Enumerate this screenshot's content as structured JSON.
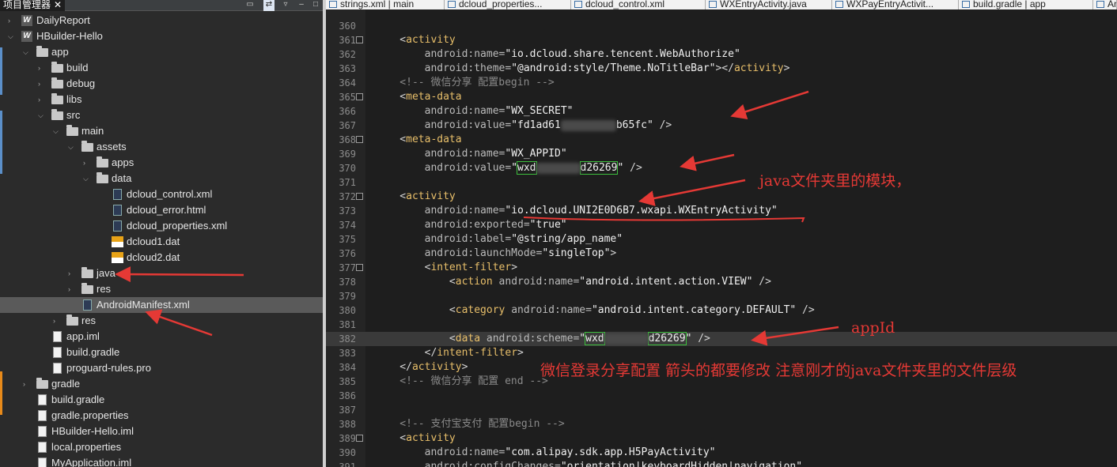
{
  "panel": {
    "title": "项目管理器",
    "close": "✕"
  },
  "tree": [
    {
      "depth": 0,
      "arrow": "right",
      "icon": "w",
      "label": "DailyReport"
    },
    {
      "depth": 0,
      "arrow": "down",
      "icon": "w",
      "label": "HBuilder-Hello"
    },
    {
      "depth": 1,
      "arrow": "down",
      "icon": "folder",
      "label": "app"
    },
    {
      "depth": 2,
      "arrow": "right",
      "icon": "folder",
      "label": "build"
    },
    {
      "depth": 2,
      "arrow": "right",
      "icon": "folder",
      "label": "debug"
    },
    {
      "depth": 2,
      "arrow": "right",
      "icon": "folder",
      "label": "libs"
    },
    {
      "depth": 2,
      "arrow": "down",
      "icon": "folder",
      "label": "src"
    },
    {
      "depth": 3,
      "arrow": "down",
      "icon": "folder",
      "label": "main"
    },
    {
      "depth": 4,
      "arrow": "down",
      "icon": "folder",
      "label": "assets"
    },
    {
      "depth": 5,
      "arrow": "right",
      "icon": "folder",
      "label": "apps"
    },
    {
      "depth": 5,
      "arrow": "down",
      "icon": "folder",
      "label": "data"
    },
    {
      "depth": 6,
      "arrow": "",
      "icon": "xml",
      "label": "dcloud_control.xml"
    },
    {
      "depth": 6,
      "arrow": "",
      "icon": "xml",
      "label": "dcloud_error.html"
    },
    {
      "depth": 6,
      "arrow": "",
      "icon": "xml",
      "label": "dcloud_properties.xml"
    },
    {
      "depth": 6,
      "arrow": "",
      "icon": "dat",
      "label": "dcloud1.dat"
    },
    {
      "depth": 6,
      "arrow": "",
      "icon": "dat",
      "label": "dcloud2.dat"
    },
    {
      "depth": 4,
      "arrow": "right",
      "icon": "folder",
      "label": "java"
    },
    {
      "depth": 4,
      "arrow": "right",
      "icon": "folder",
      "label": "res"
    },
    {
      "depth": 4,
      "arrow": "",
      "icon": "xml",
      "label": "AndroidManifest.xml",
      "selected": true
    },
    {
      "depth": 3,
      "arrow": "right",
      "icon": "folder",
      "label": "res"
    },
    {
      "depth": 2,
      "arrow": "",
      "icon": "file",
      "label": "app.iml"
    },
    {
      "depth": 2,
      "arrow": "",
      "icon": "file",
      "label": "build.gradle"
    },
    {
      "depth": 2,
      "arrow": "",
      "icon": "file",
      "label": "proguard-rules.pro"
    },
    {
      "depth": 1,
      "arrow": "right",
      "icon": "folder",
      "label": "gradle"
    },
    {
      "depth": 1,
      "arrow": "",
      "icon": "file",
      "label": "build.gradle"
    },
    {
      "depth": 1,
      "arrow": "",
      "icon": "file",
      "label": "gradle.properties"
    },
    {
      "depth": 1,
      "arrow": "",
      "icon": "file",
      "label": "HBuilder-Hello.iml"
    },
    {
      "depth": 1,
      "arrow": "",
      "icon": "file",
      "label": "local.properties"
    },
    {
      "depth": 1,
      "arrow": "",
      "icon": "file",
      "label": "MyApplication.iml"
    }
  ],
  "tabs": [
    "strings.xml | main",
    "dcloud_properties...",
    "dcloud_control.xml",
    "WXEntryActivity.java",
    "WXPayEntryActivit...",
    "build.gradle | app",
    "And"
  ],
  "code": [
    {
      "n": "360",
      "fold": false,
      "parts": []
    },
    {
      "n": "361",
      "fold": true,
      "parts": [
        [
          "punc",
          "    <"
        ],
        [
          "tagname",
          "activity"
        ]
      ]
    },
    {
      "n": "362",
      "fold": false,
      "parts": [
        [
          "attr",
          "        android:name="
        ],
        [
          "val",
          "\"io.dcloud.share.tencent.WebAuthorize\""
        ]
      ]
    },
    {
      "n": "363",
      "fold": false,
      "parts": [
        [
          "attr",
          "        android:theme="
        ],
        [
          "val",
          "\"@android:style/Theme.NoTitleBar\""
        ],
        [
          "punc",
          "></"
        ],
        [
          "tagname",
          "activity"
        ],
        [
          "punc",
          ">"
        ]
      ]
    },
    {
      "n": "364",
      "fold": false,
      "parts": [
        [
          "cmt",
          "    <!-- 微信分享 配置begin -->"
        ]
      ]
    },
    {
      "n": "365",
      "fold": true,
      "parts": [
        [
          "punc",
          "    <"
        ],
        [
          "tagname",
          "meta-data"
        ]
      ]
    },
    {
      "n": "366",
      "fold": false,
      "parts": [
        [
          "attr",
          "        android:name="
        ],
        [
          "val",
          "\"WX_SECRET\""
        ]
      ]
    },
    {
      "n": "367",
      "fold": false,
      "parts": [
        [
          "attr",
          "        android:value="
        ],
        [
          "val",
          "\"fd1ad61"
        ],
        [
          "blur",
          ""
        ],
        [
          "val",
          "b65fc\""
        ],
        [
          "punc",
          " />"
        ]
      ]
    },
    {
      "n": "368",
      "fold": true,
      "parts": [
        [
          "punc",
          "    <"
        ],
        [
          "tagname",
          "meta-data"
        ]
      ]
    },
    {
      "n": "369",
      "fold": false,
      "parts": [
        [
          "attr",
          "        android:name="
        ],
        [
          "val",
          "\"WX_APPID\""
        ]
      ]
    },
    {
      "n": "370",
      "fold": false,
      "parts": [
        [
          "attr",
          "        android:value="
        ],
        [
          "val",
          "\""
        ],
        [
          "boxed",
          "wxd"
        ],
        [
          "blurs",
          ""
        ],
        [
          "boxed",
          "d26269"
        ],
        [
          "val",
          "\""
        ],
        [
          "punc",
          " />"
        ]
      ]
    },
    {
      "n": "371",
      "fold": false,
      "parts": []
    },
    {
      "n": "372",
      "fold": true,
      "parts": [
        [
          "punc",
          "    <"
        ],
        [
          "tagname",
          "activity"
        ]
      ]
    },
    {
      "n": "373",
      "fold": false,
      "parts": [
        [
          "attr",
          "        android:name="
        ],
        [
          "val",
          "\"io.dcloud.UNI2E0D6B7.wxapi.WXEntryActivity\""
        ]
      ]
    },
    {
      "n": "374",
      "fold": false,
      "parts": [
        [
          "attr",
          "        android:exported="
        ],
        [
          "val",
          "\"true\""
        ]
      ]
    },
    {
      "n": "375",
      "fold": false,
      "parts": [
        [
          "attr",
          "        android:label="
        ],
        [
          "val",
          "\"@string/app_name\""
        ]
      ]
    },
    {
      "n": "376",
      "fold": false,
      "parts": [
        [
          "attr",
          "        android:launchMode="
        ],
        [
          "val",
          "\"singleTop\""
        ],
        [
          "punc",
          ">"
        ]
      ]
    },
    {
      "n": "377",
      "fold": true,
      "parts": [
        [
          "punc",
          "        <"
        ],
        [
          "tagname",
          "intent-filter"
        ],
        [
          "punc",
          ">"
        ]
      ]
    },
    {
      "n": "378",
      "fold": false,
      "parts": [
        [
          "punc",
          "            <"
        ],
        [
          "tagname",
          "action"
        ],
        [
          "attr",
          " android:name="
        ],
        [
          "val",
          "\"android.intent.action.VIEW\""
        ],
        [
          "punc",
          " />"
        ]
      ]
    },
    {
      "n": "379",
      "fold": false,
      "parts": []
    },
    {
      "n": "380",
      "fold": false,
      "parts": [
        [
          "punc",
          "            <"
        ],
        [
          "tagname",
          "category"
        ],
        [
          "attr",
          " android:name="
        ],
        [
          "val",
          "\"android.intent.category.DEFAULT\""
        ],
        [
          "punc",
          " />"
        ]
      ]
    },
    {
      "n": "381",
      "fold": false,
      "parts": []
    },
    {
      "n": "382",
      "fold": false,
      "current": true,
      "parts": [
        [
          "punc",
          "            <"
        ],
        [
          "tagname",
          "data"
        ],
        [
          "attr",
          " android:scheme="
        ],
        [
          "val",
          "\""
        ],
        [
          "boxed",
          "wxd"
        ],
        [
          "blurs",
          ""
        ],
        [
          "boxed",
          "d26269"
        ],
        [
          "val",
          "\""
        ],
        [
          "punc",
          " />"
        ]
      ]
    },
    {
      "n": "383",
      "fold": false,
      "parts": [
        [
          "punc",
          "        </"
        ],
        [
          "tagname",
          "intent-filter"
        ],
        [
          "punc",
          ">"
        ]
      ]
    },
    {
      "n": "384",
      "fold": false,
      "parts": [
        [
          "punc",
          "    </"
        ],
        [
          "tagname",
          "activity"
        ],
        [
          "punc",
          ">"
        ]
      ]
    },
    {
      "n": "385",
      "fold": false,
      "parts": [
        [
          "cmt",
          "    <!-- 微信分享 配置 end -->"
        ]
      ]
    },
    {
      "n": "386",
      "fold": false,
      "parts": []
    },
    {
      "n": "387",
      "fold": false,
      "parts": []
    },
    {
      "n": "388",
      "fold": false,
      "parts": [
        [
          "cmt",
          "    <!-- 支付宝支付 配置begin -->"
        ]
      ]
    },
    {
      "n": "389",
      "fold": true,
      "parts": [
        [
          "punc",
          "    <"
        ],
        [
          "tagname",
          "activity"
        ]
      ]
    },
    {
      "n": "390",
      "fold": false,
      "parts": [
        [
          "attr",
          "        android:name="
        ],
        [
          "val",
          "\"com.alipay.sdk.app.H5PayActivity\""
        ]
      ]
    },
    {
      "n": "391",
      "fold": false,
      "parts": [
        [
          "attr",
          "        android:configChanges="
        ],
        [
          "val",
          "\"orientation|keyboardHidden|navigation\""
        ]
      ]
    }
  ],
  "annotations": {
    "java_module": "java文件夹里的模块，",
    "app_id": "appId",
    "config_note": "微信登录分享配置 箭头的都要修改 注意刚才的java文件夹里的文件层级"
  },
  "colors": {
    "annotation": "#e53935",
    "highlight_box": "#3dbf3d"
  }
}
